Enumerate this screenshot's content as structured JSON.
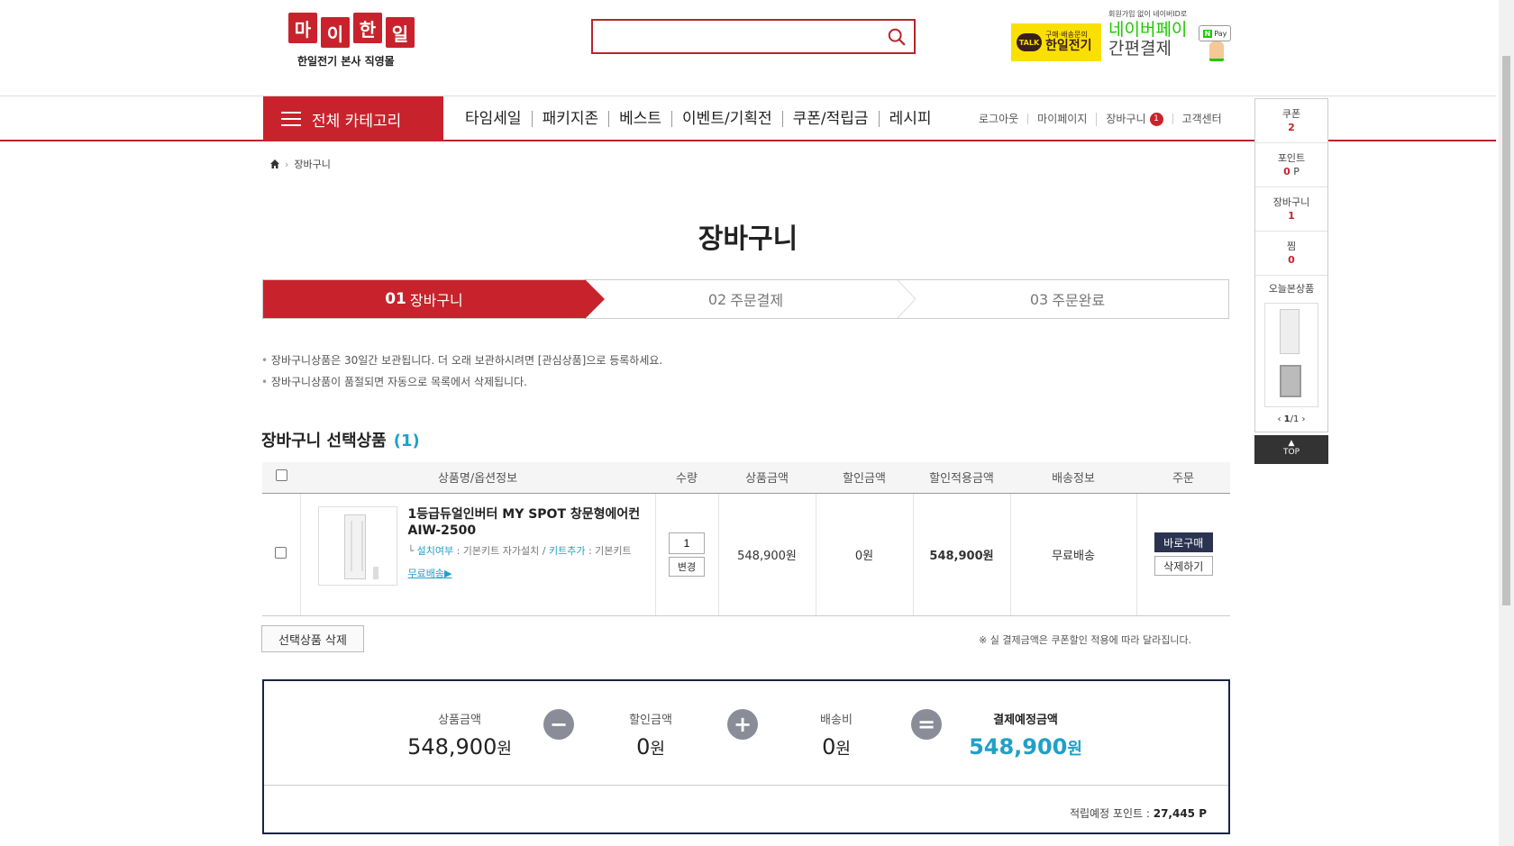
{
  "header": {
    "logo_chars": [
      "마",
      "이",
      "한",
      "일"
    ],
    "logo_sub": "한일전기 본사 직영몰",
    "search_placeholder": "",
    "talk_small": "구매·배송문의",
    "talk_big": "한일전기",
    "talk_badge": "TALK",
    "naver_small": "회원가입 없이 네이버ID로",
    "naver_line1": "네이버페이",
    "naver_line2": "간편결제",
    "npay_label": "Pay"
  },
  "nav": {
    "category_label": "전체 카테고리",
    "main_items": [
      "타임세일",
      "패키지존",
      "베스트",
      "이벤트/기획전",
      "쿠폰/적립금",
      "레시피"
    ],
    "util_items": [
      "로그아웃",
      "마이페이지",
      "장바구니",
      "고객센터"
    ],
    "cart_count": "1"
  },
  "side": {
    "items": [
      {
        "label": "쿠폰",
        "value": "2"
      },
      {
        "label": "포인트",
        "value": "0",
        "unit": "P"
      },
      {
        "label": "장바구니",
        "value": "1"
      },
      {
        "label": "찜",
        "value": "0"
      }
    ],
    "recent_label": "오늘본상품",
    "pager_current": "1",
    "pager_total": "/1",
    "top_label": "TOP"
  },
  "breadcrumb": {
    "current": "장바구니"
  },
  "page_title": "장바구니",
  "steps": [
    {
      "num": "01",
      "label": "장바구니"
    },
    {
      "num": "02",
      "label": "주문결제"
    },
    {
      "num": "03",
      "label": "주문완료"
    }
  ],
  "notes": [
    "장바구니상품은 30일간 보관됩니다. 더 오래 보관하시려면 [관심상품]으로 등록하세요.",
    "장바구니상품이 품절되면 자동으로 목록에서 삭제됩니다."
  ],
  "selected": {
    "title": "장바구니 선택상품",
    "count": "(1)"
  },
  "table": {
    "headers": [
      "상품명/옵션정보",
      "수량",
      "상품금액",
      "할인금액",
      "할인적용금액",
      "배송정보",
      "주문"
    ],
    "row": {
      "name": "1등급듀얼인버터 MY SPOT 창문형에어컨 AIW-2500",
      "opt1_key": "설치여부",
      "opt1_val": " : 기본키트 자가설치 / ",
      "opt2_key": "키트추가",
      "opt2_val": " : 기본키트",
      "ship_link": "무료배송▶",
      "qty": "1",
      "change_label": "변경",
      "price": "548,900원",
      "discount": "0원",
      "final": "548,900원",
      "delivery": "무료배송",
      "buy_label": "바로구매",
      "delete_label": "삭제하기"
    }
  },
  "actions": {
    "delete_selected": "선택상품 삭제",
    "pay_note": "※ 실 결제금액은 쿠폰할인 적용에 따라 달라집니다."
  },
  "summary": {
    "product_label": "상품금액",
    "product_value": "548,900",
    "discount_label": "할인금액",
    "discount_value": "0",
    "shipping_label": "배송비",
    "shipping_value": "0",
    "total_label": "결제예정금액",
    "total_value": "548,900",
    "won": "원",
    "op_minus": "−",
    "op_plus": "+",
    "op_equals": "=",
    "points_label": "적립예정 포인트 : ",
    "points_value": "27,445 P"
  },
  "colors": {
    "brand_red": "#c8232c",
    "accent_blue": "#1fa0c8",
    "navy": "#1a2444"
  }
}
